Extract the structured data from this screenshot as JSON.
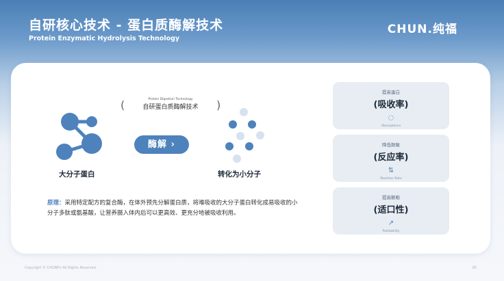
{
  "header": {
    "title": "自研核心技术 - 蛋白质酶解技术",
    "subtitle": "Protein Enzymatic Hydrolysis Technology",
    "logo": "CHUN.纯福"
  },
  "diagram": {
    "tech_en": "Protein Digestion Technology",
    "tech_cn": "自研蛋白质酶解技术",
    "paren_left": "(",
    "paren_right": ")",
    "enzyme_button": "酶解 ›",
    "left_label": "大分子蛋白",
    "right_label": "转化为小分子"
  },
  "principle": {
    "key": "原理：",
    "text": "采用特定配方的复合酶，在体外预先分解蛋白质，将难吸收的大分子蛋白转化成易吸收的小分子多肽或氨基酸，让营养摄入体内后可以更高效、更充分地被吸收利用。"
  },
  "benefits": [
    {
      "small": "提高蛋白",
      "big": "(吸收率)",
      "icon": "◌",
      "en": "Absorptance"
    },
    {
      "small": "降低致敏",
      "big": "(反应率)",
      "icon": "⇅",
      "en": "Reaction Rate"
    },
    {
      "small": "提高颤粮",
      "big": "(适口性)",
      "icon": "↗",
      "en": "Palatability"
    }
  ],
  "colors": {
    "accent": "#4e82bc",
    "light_dot": "#d6e2ef",
    "box_bg": "#e8edf3"
  },
  "footer": {
    "copyright": "Copyright © CHUNFU All Rights Reserved.",
    "page": "05"
  }
}
